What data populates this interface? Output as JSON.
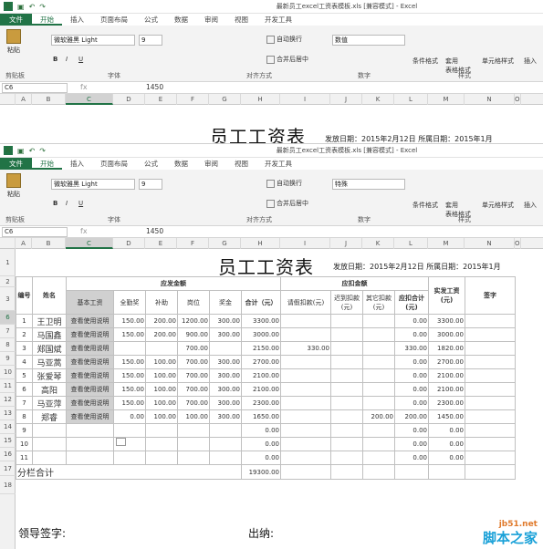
{
  "window_title": "最新员工excel工资表模板.xls [兼容模式] - Excel",
  "tabs": [
    "文件",
    "开始",
    "插入",
    "页面布局",
    "公式",
    "数据",
    "审阅",
    "视图",
    "开发工具"
  ],
  "active_tab": "开始",
  "ribbon": {
    "paste_label": "粘贴",
    "clipboard_group": "剪贴板",
    "font_name": "微软雅黑 Light",
    "font_size": "9",
    "font_group": "字体",
    "wrap_text": "自动换行",
    "merge_center": "合并后居中",
    "align_group": "对齐方式",
    "number_format_top": "数值",
    "number_format_bottom": "特殊",
    "number_group": "数字",
    "cond_format": "条件格式",
    "table_format": "套用\n表格格式",
    "cell_style": "单元格样式",
    "styles_group": "样式",
    "insert": "插入",
    "bold": "B",
    "italic": "I",
    "underline": "U"
  },
  "name_box": "C6",
  "formula_value": "1450",
  "formula_fx": "fx",
  "columns": [
    "A",
    "B",
    "C",
    "D",
    "E",
    "F",
    "G",
    "H",
    "I",
    "J",
    "K",
    "L",
    "M",
    "N",
    "O"
  ],
  "selected_column": "C",
  "sheet": {
    "title": "员工工资表",
    "issue_date": "发放日期：2015年2月12日",
    "belong_date": "所属日期：2015年1月",
    "top_headers": {
      "num": "编号",
      "name": "姓名",
      "pay_group": "应发金额",
      "deduct_group": "应扣金额",
      "sign": "签字"
    },
    "sub_headers": [
      "基本工资",
      "全勤奖",
      "补助",
      "岗位",
      "奖金",
      "合计（元）",
      "请假扣款(元)",
      "迟到扣款(元)",
      "其它扣款(元)",
      "应扣合计(元)",
      "实发工资(元)"
    ],
    "rows": [
      {
        "rownum": "6",
        "no": "1",
        "name": "王卫明",
        "base": "查看使用说明",
        "attend": "150.00",
        "allow": "200.00",
        "post": "1200.00",
        "bonus": "300.00",
        "total": "3300.00",
        "leave": "",
        "late": "",
        "other": "",
        "deduct": "0.00",
        "net": "3300.00"
      },
      {
        "rownum": "7",
        "no": "2",
        "name": "马国鑫",
        "base": "查看使用说明",
        "attend": "150.00",
        "allow": "200.00",
        "post": "900.00",
        "bonus": "300.00",
        "total": "3000.00",
        "leave": "",
        "late": "",
        "other": "",
        "deduct": "0.00",
        "net": "3000.00"
      },
      {
        "rownum": "8",
        "no": "3",
        "name": "郑国斌",
        "base": "查看使用说明",
        "attend": "",
        "allow": "",
        "post": "700.00",
        "bonus": "",
        "total": "2150.00",
        "leave": "330.00",
        "late": "",
        "other": "",
        "deduct": "330.00",
        "net": "1820.00"
      },
      {
        "rownum": "9",
        "no": "4",
        "name": "马亚蒿",
        "base": "查看使用说明",
        "attend": "150.00",
        "allow": "100.00",
        "post": "700.00",
        "bonus": "300.00",
        "total": "2700.00",
        "leave": "",
        "late": "",
        "other": "",
        "deduct": "0.00",
        "net": "2700.00"
      },
      {
        "rownum": "10",
        "no": "5",
        "name": "张爱琴",
        "base": "查看使用说明",
        "attend": "150.00",
        "allow": "100.00",
        "post": "700.00",
        "bonus": "300.00",
        "total": "2100.00",
        "leave": "",
        "late": "",
        "other": "",
        "deduct": "0.00",
        "net": "2100.00"
      },
      {
        "rownum": "11",
        "no": "6",
        "name": "高阳",
        "base": "查看使用说明",
        "attend": "150.00",
        "allow": "100.00",
        "post": "700.00",
        "bonus": "300.00",
        "total": "2100.00",
        "leave": "",
        "late": "",
        "other": "",
        "deduct": "0.00",
        "net": "2100.00"
      },
      {
        "rownum": "12",
        "no": "7",
        "name": "马亚萍",
        "base": "查看使用说明",
        "attend": "150.00",
        "allow": "100.00",
        "post": "700.00",
        "bonus": "300.00",
        "total": "2300.00",
        "leave": "",
        "late": "",
        "other": "",
        "deduct": "0.00",
        "net": "2300.00"
      },
      {
        "rownum": "13",
        "no": "8",
        "name": "郑睿",
        "base": "查看使用说明",
        "attend": "0.00",
        "allow": "100.00",
        "post": "100.00",
        "bonus": "300.00",
        "total": "1650.00",
        "leave": "",
        "late": "",
        "other": "200.00",
        "deduct": "200.00",
        "net": "1450.00"
      },
      {
        "rownum": "14",
        "no": "9",
        "name": "",
        "base": "",
        "attend": "",
        "allow": "",
        "post": "",
        "bonus": "",
        "total": "0.00",
        "leave": "",
        "late": "",
        "other": "",
        "deduct": "0.00",
        "net": "0.00"
      },
      {
        "rownum": "15",
        "no": "10",
        "name": "",
        "base": "",
        "attend": "",
        "allow": "",
        "post": "",
        "bonus": "",
        "total": "0.00",
        "leave": "",
        "late": "",
        "other": "",
        "deduct": "0.00",
        "net": "0.00"
      },
      {
        "rownum": "16",
        "no": "11",
        "name": "",
        "base": "",
        "attend": "",
        "allow": "",
        "post": "",
        "bonus": "",
        "total": "0.00",
        "leave": "",
        "late": "",
        "other": "",
        "deduct": "0.00",
        "net": "0.00"
      }
    ],
    "subtotal_label": "分栏合计",
    "subtotal_value": "19300.00",
    "leader_sign": "领导签字:",
    "cashier": "出纳:"
  },
  "watermark_top": "jb51.net",
  "watermark_bottom": "脚本之家"
}
